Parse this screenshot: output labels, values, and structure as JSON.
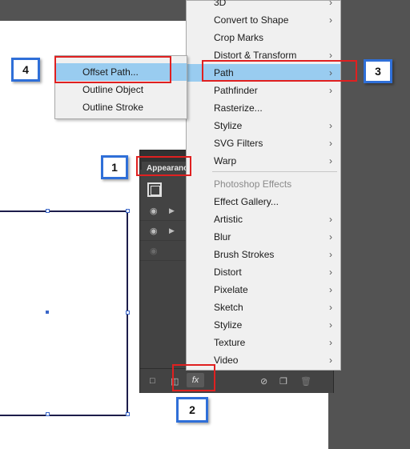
{
  "appearance_panel": {
    "tab_label": "Appearance",
    "footer_fx_label": "fx"
  },
  "effect_menu": {
    "items_top": [
      "3D",
      "Convert to Shape",
      "Crop Marks",
      "Distort & Transform",
      "Path",
      "Pathfinder",
      "Rasterize...",
      "Stylize",
      "SVG Filters",
      "Warp"
    ],
    "section_header": "Photoshop Effects",
    "items_bottom": [
      "Effect Gallery...",
      "Artistic",
      "Blur",
      "Brush Strokes",
      "Distort",
      "Pixelate",
      "Sketch",
      "Stylize",
      "Texture",
      "Video"
    ],
    "highlighted_item": "Path"
  },
  "path_submenu": {
    "items": [
      "Offset Path...",
      "Outline Object",
      "Outline Stroke"
    ],
    "highlighted_item": "Offset Path..."
  },
  "callouts": {
    "step1": "1",
    "step2": "2",
    "step3": "3",
    "step4": "4"
  },
  "colors": {
    "menu_highlight": "#99ccf0",
    "callout_border": "#2f6fd8",
    "highlight_box": "#e02020",
    "workspace": "#535353"
  }
}
